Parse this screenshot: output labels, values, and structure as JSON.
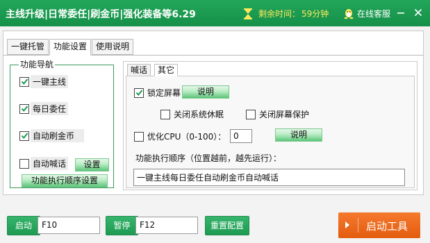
{
  "titlebar": {
    "title": "主线升级|日常委任|刷金币|强化装备等6.29",
    "timer_label": "剩余时间：",
    "timer_value": "59分钟",
    "service_label": "在线客服",
    "accent_color": "#1a9a50",
    "timer_color": "#ffe95c"
  },
  "tabs": [
    "一键托管",
    "功能设置",
    "使用说明"
  ],
  "active_tab": "功能设置",
  "nav": {
    "title": "功能导航",
    "items": [
      {
        "label": "一键主线",
        "checked": true
      },
      {
        "label": "每日委任",
        "checked": true
      },
      {
        "label": "自动刷金币",
        "checked": true
      },
      {
        "label": "自动喊话",
        "checked": false
      }
    ],
    "settings_button": "设置",
    "order_button": "功能执行顺序设置"
  },
  "subtabs": [
    "喊话",
    "其它"
  ],
  "active_subtab": "其它",
  "other": {
    "lock_screen_label": "锁定屏幕",
    "lock_screen_checked": true,
    "explain_button": "说明",
    "sleep_label": "关闭系统休眠",
    "sleep_checked": false,
    "screensaver_label": "关闭屏幕保护",
    "screensaver_checked": false,
    "cpu_label": "优化CPU（0-100）：",
    "cpu_checked": false,
    "cpu_value": "0",
    "cpu_explain_button": "说明",
    "order_label": "功能执行顺序（位置越前，越先运行）：",
    "order_value": "一键主线每日委任自动刷金币自动喊话"
  },
  "footer": {
    "start_button": "启动",
    "start_hotkey": "F10",
    "pause_button": "暂停",
    "pause_hotkey": "F12",
    "reset_button": "重置配置",
    "launch_button": "启动工具",
    "launch_color": "#ef6a1f"
  }
}
